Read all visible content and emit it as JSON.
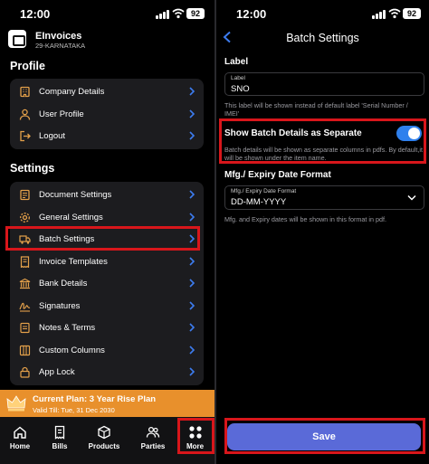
{
  "status_left": {
    "time": "12:00",
    "battery": "92"
  },
  "status_right": {
    "time": "12:00",
    "battery": "92"
  },
  "brand": {
    "name": "EInvoices",
    "subtitle": "29-KARNATAKA"
  },
  "profile": {
    "title": "Profile",
    "items": [
      {
        "label": "Company Details",
        "icon": "building-icon"
      },
      {
        "label": "User Profile",
        "icon": "user-icon"
      },
      {
        "label": "Logout",
        "icon": "logout-icon"
      }
    ]
  },
  "settings": {
    "title": "Settings",
    "items": [
      {
        "label": "Document Settings",
        "icon": "document-icon"
      },
      {
        "label": "General Settings",
        "icon": "gear-icon"
      },
      {
        "label": "Batch Settings",
        "icon": "truck-icon"
      },
      {
        "label": "Invoice Templates",
        "icon": "invoice-icon"
      },
      {
        "label": "Bank Details",
        "icon": "bank-icon"
      },
      {
        "label": "Signatures",
        "icon": "signature-icon"
      },
      {
        "label": "Notes & Terms",
        "icon": "notes-icon"
      },
      {
        "label": "Custom Columns",
        "icon": "columns-icon"
      },
      {
        "label": "App Lock",
        "icon": "lock-icon"
      }
    ]
  },
  "plan": {
    "title": "Current Plan: 3 Year Rise Plan",
    "valid": "Valid Till: Tue, 31 Dec 2030"
  },
  "tabs": [
    {
      "label": "Home",
      "icon": "home-icon"
    },
    {
      "label": "Bills",
      "icon": "bill-icon"
    },
    {
      "label": "Products",
      "icon": "box-icon"
    },
    {
      "label": "Parties",
      "icon": "users-icon"
    },
    {
      "label": "More",
      "icon": "grid-icon"
    }
  ],
  "batch": {
    "nav_title": "Batch Settings",
    "label_heading": "Label",
    "label_field_label": "Label",
    "label_value": "SNO",
    "label_hint": "This label will be shown instead of default label 'Serial Number / IMEI'",
    "toggle_label": "Show Batch Details as Separate",
    "toggle_on": true,
    "toggle_hint": "Batch details will be shown as separate columns in pdfs. By default,it will be shown under the item name.",
    "date_heading": "Mfg./ Expiry Date Format",
    "date_field_label": "Mfg./ Expiry Date Format",
    "date_value": "DD-MM-YYYY",
    "date_hint": "Mfg. and Expiry dates will be shown in this format in pdf.",
    "save_label": "Save"
  },
  "colors": {
    "accent": "#e3a04a",
    "highlight": "#d8161b",
    "toggle": "#2f80ed",
    "save": "#5a6ad8",
    "plan": "#e8902c"
  }
}
